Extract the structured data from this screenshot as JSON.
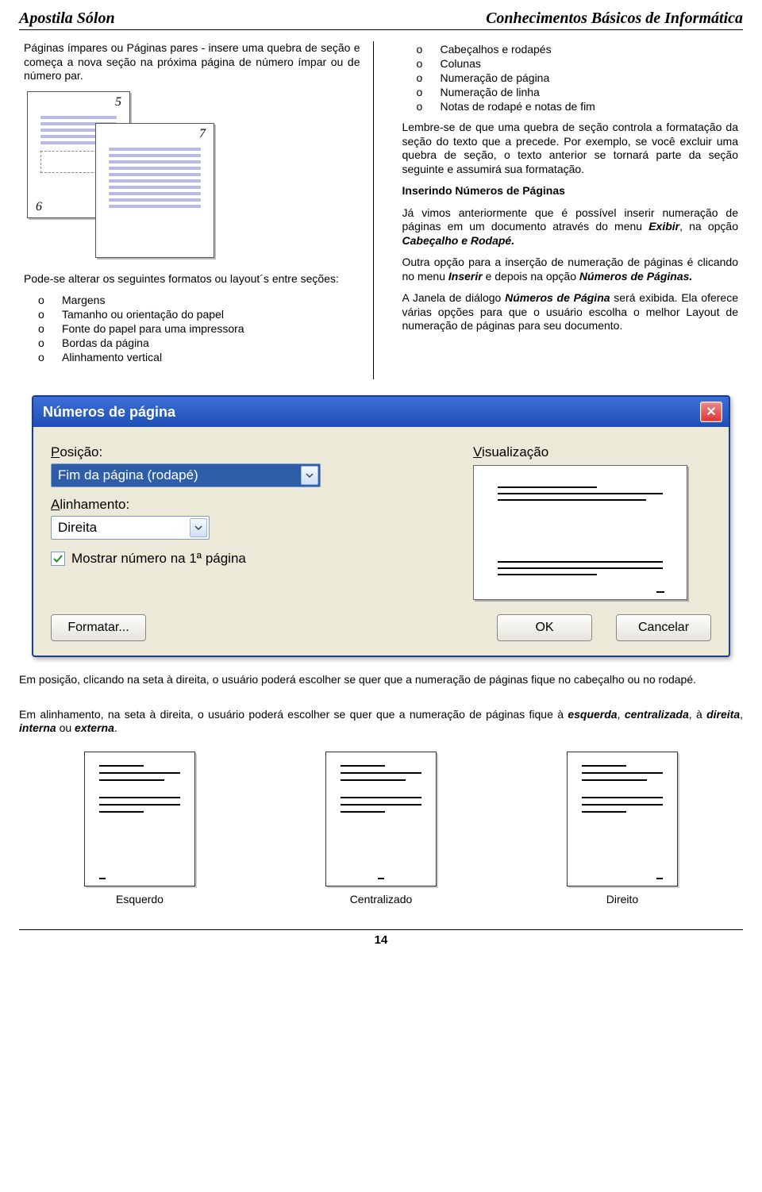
{
  "header": {
    "left": "Apostila Sólon",
    "right": "Conhecimentos Básicos de Informática"
  },
  "left_col": {
    "intro": "Páginas ímpares ou Páginas pares - insere uma quebra de seção e começa a nova seção na próxima página de número ímpar ou de número par.",
    "diagram_nums": {
      "p5": "5",
      "p6": "6",
      "p7": "7"
    },
    "layouts_lead": "Pode-se alterar os seguintes formatos ou layout´s entre seções:",
    "layouts": [
      "Margens",
      "Tamanho ou orientação do papel",
      "Fonte do papel para uma impressora",
      "Bordas da página",
      "Alinhamento vertical"
    ]
  },
  "right_col": {
    "list_top": [
      "Cabeçalhos e rodapés",
      "Colunas",
      "Numeração de página",
      "Numeração de linha",
      "Notas de rodapé e notas de fim"
    ],
    "para1": "Lembre-se de que uma quebra de seção controla a formatação da seção do texto que a precede. Por exemplo, se você excluir uma quebra de seção, o texto anterior se tornará parte da seção seguinte e assumirá sua formatação.",
    "heading": "Inserindo Números de Páginas",
    "para2_a": "Já vimos anteriormente que é possível inserir numeração de páginas em um documento através do menu ",
    "para2_b": "Exibir",
    "para2_c": ", na opção ",
    "para2_d": "Cabeçalho e Rodapé.",
    "para3_a": "Outra opção para a inserção de numeração de páginas é clicando no menu ",
    "para3_b": "Inserir",
    "para3_c": " e depois na opção ",
    "para3_d": "Números de Páginas.",
    "para4_a": " A Janela de diálogo ",
    "para4_b": "Números de Página",
    "para4_c": " será exibida. Ela oferece várias opções para que o usuário escolha o melhor Layout de numeração de páginas para seu documento."
  },
  "dialog": {
    "title": "Números de página",
    "posicao_lbl_pre": "P",
    "posicao_lbl_rest": "osição:",
    "posicao_val": "Fim da página (rodapé)",
    "alinh_lbl_pre": "A",
    "alinh_lbl_rest": "linhamento:",
    "alinh_val": "Direita",
    "chk_lbl_pre": "M",
    "chk_lbl_rest": "ostrar número na 1ª página",
    "vis_lbl_pre": "V",
    "vis_lbl_rest": "isualização",
    "btn_format": "Formatar...",
    "btn_ok": "OK",
    "btn_cancel": "Cancelar"
  },
  "below": {
    "para1": "Em posição, clicando na seta à direita, o usuário poderá escolher se quer que a numeração de páginas fique no cabeçalho ou no rodapé.",
    "para2_a": "Em alinhamento, na seta à direita, o usuário poderá escolher se quer que a numeração de páginas fique à ",
    "w1": "esquerda",
    "sep1": ", ",
    "w2": "centralizada",
    "sep2": ", à ",
    "w3": "direita",
    "sep3": ", ",
    "w4": "interna",
    "sep4": " ou ",
    "w5": "externa",
    "sep5": "."
  },
  "align_labels": {
    "left": "Esquerdo",
    "center": "Centralizado",
    "right": "Direito"
  },
  "footer_page": "14"
}
